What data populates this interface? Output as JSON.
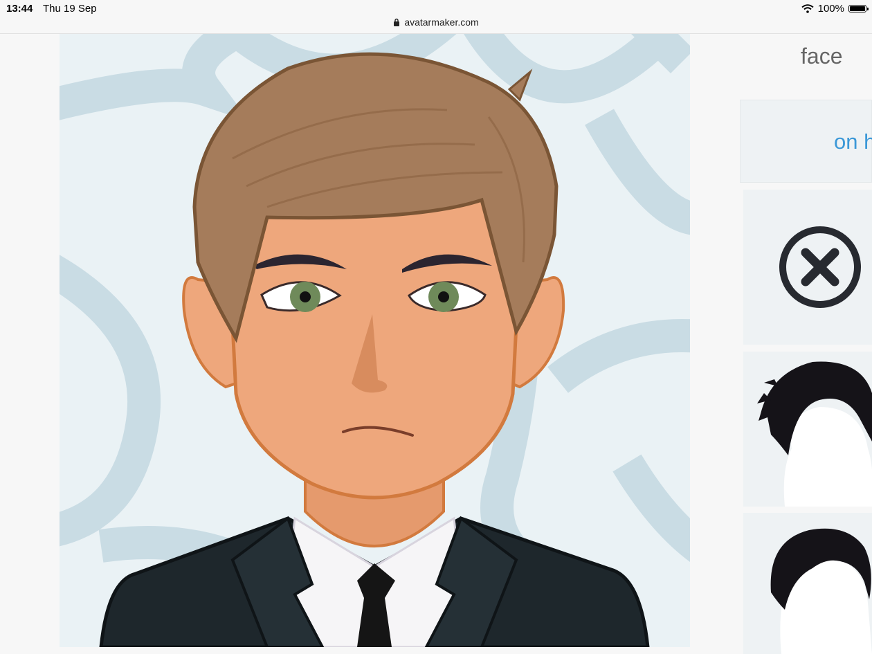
{
  "status_bar": {
    "time": "13:44",
    "date": "Thu 19 Sep",
    "url": "avatarmaker.com",
    "battery_percent": "100%",
    "battery_level": 1.0
  },
  "panel": {
    "category": "face",
    "tab_label": "on h",
    "options": [
      {
        "name": "none",
        "icon": "close-circle-icon"
      },
      {
        "name": "hair-style-1",
        "icon": "spiky-hair-icon"
      },
      {
        "name": "hair-style-2",
        "icon": "short-hair-icon"
      }
    ]
  },
  "colors": {
    "background_pattern": "#c9dce4",
    "background_base": "#eaf2f5",
    "skin": "#eea77c",
    "hair": "#a57c5b",
    "suit": "#1e272c",
    "accent_link": "#3b98d7",
    "eyes": "#6f8a5a"
  }
}
